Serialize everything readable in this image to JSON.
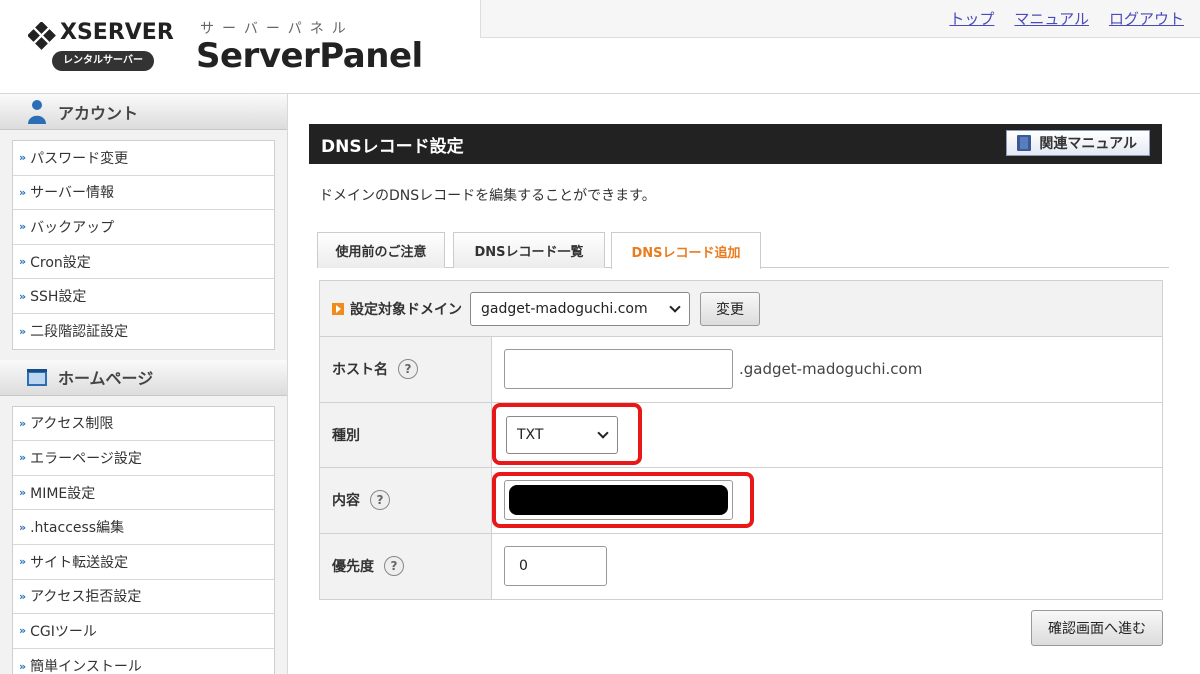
{
  "header": {
    "logo_text": "XSERVER",
    "logo_badge": "レンタルサーバー",
    "panel_kana": "サーバーパネル",
    "panel_name": "ServerPanel",
    "links": [
      "トップ",
      "マニュアル",
      "ログアウト"
    ]
  },
  "sidebar": {
    "sections": [
      {
        "title": "アカウント",
        "icon": "user-icon",
        "items": [
          "パスワード変更",
          "サーバー情報",
          "バックアップ",
          "Cron設定",
          "SSH設定",
          "二段階認証設定"
        ]
      },
      {
        "title": "ホームページ",
        "icon": "homepage-icon",
        "items": [
          "アクセス制限",
          "エラーページ設定",
          "MIME設定",
          ".htaccess編集",
          "サイト転送設定",
          "アクセス拒否設定",
          "CGIツール",
          "簡単インストール"
        ]
      }
    ]
  },
  "main": {
    "title": "DNSレコード設定",
    "manual_button": "関連マニュアル",
    "description": "ドメインのDNSレコードを編集することができます。",
    "tabs": [
      "使用前のご注意",
      "DNSレコード一覧",
      "DNSレコード追加"
    ],
    "active_tab": "DNSレコード追加",
    "domain_label": "設定対象ドメイン",
    "domain_value": "gadget-madoguchi.com",
    "change_button": "変更",
    "fields": {
      "host_label": "ホスト名",
      "host_value": "",
      "host_suffix": ".gadget-madoguchi.com",
      "type_label": "種別",
      "type_value": "TXT",
      "content_label": "内容",
      "priority_label": "優先度",
      "priority_value": "0"
    },
    "help_mark": "?",
    "confirm_button": "確認画面へ進む"
  },
  "colors": {
    "highlight": "#e81818",
    "active_tab": "#e87c1e",
    "link": "#4b4bb8"
  }
}
